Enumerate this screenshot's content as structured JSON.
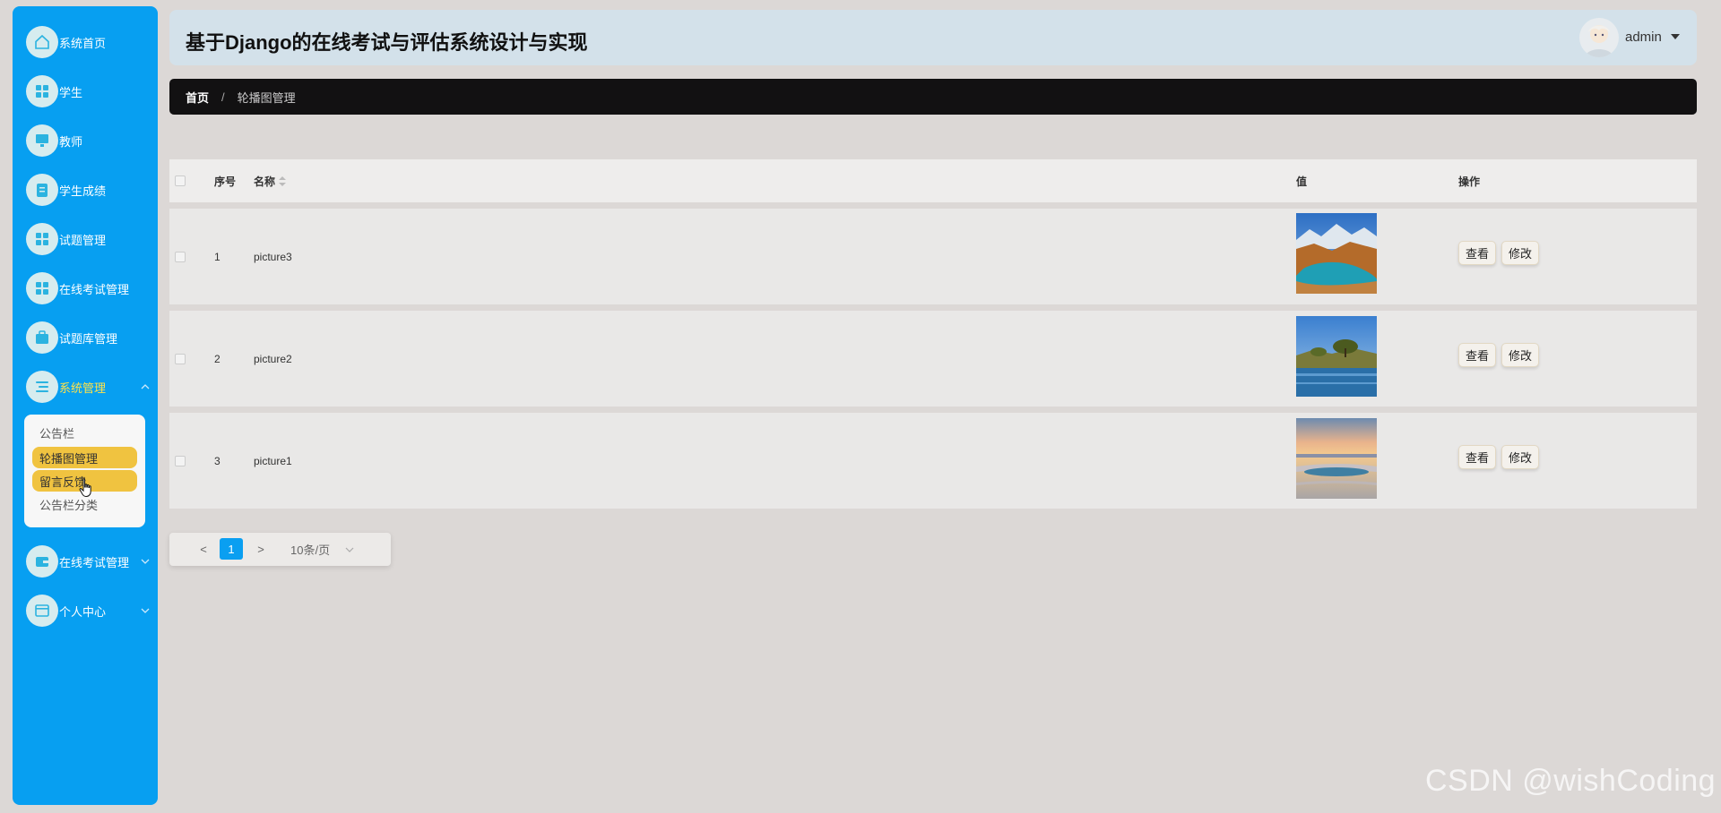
{
  "header": {
    "title": "基于Django的在线考试与评估系统设计与实现",
    "user_name": "admin"
  },
  "breadcrumb": {
    "home": "首页",
    "separator": "/",
    "current": "轮播图管理"
  },
  "sidebar": {
    "items": [
      {
        "label": "系统首页",
        "icon": "home-icon"
      },
      {
        "label": "学生",
        "icon": "grid-icon"
      },
      {
        "label": "教师",
        "icon": "monitor-icon"
      },
      {
        "label": "学生成绩",
        "icon": "clipboard-icon"
      },
      {
        "label": "试题管理",
        "icon": "grid-icon"
      },
      {
        "label": "在线考试管理",
        "icon": "grid-icon"
      },
      {
        "label": "试题库管理",
        "icon": "briefcase-icon"
      },
      {
        "label": "系统管理",
        "icon": "list-icon",
        "expanded": true
      },
      {
        "label": "在线考试管理",
        "icon": "wallet-icon"
      },
      {
        "label": "个人中心",
        "icon": "card-icon"
      }
    ],
    "submenu": [
      "公告栏",
      "轮播图管理",
      "留言反馈",
      "公告栏分类"
    ]
  },
  "table": {
    "columns": [
      "序号",
      "名称",
      "值",
      "操作"
    ],
    "rows": [
      {
        "index": "1",
        "name": "picture3",
        "image": "desert-mountain-lake"
      },
      {
        "index": "2",
        "name": "picture2",
        "image": "lake-trees-blue-sky"
      },
      {
        "index": "3",
        "name": "picture1",
        "image": "sunset-beach"
      }
    ],
    "view_label": "查看",
    "edit_label": "修改"
  },
  "pagination": {
    "prev": "<",
    "current": "1",
    "next": ">",
    "page_size": "10条/页"
  },
  "watermark": "CSDN @wishCoding",
  "colors": {
    "sidebar": "#079ff1",
    "active_menu": "#ffe24a",
    "submenu_highlight": "#f0c340",
    "breadcrumb_bg": "#121112",
    "header_bg": "#d3e1ea"
  }
}
